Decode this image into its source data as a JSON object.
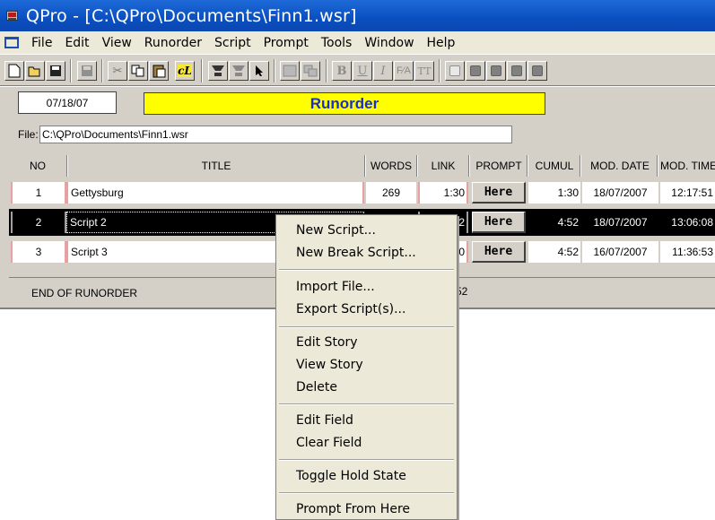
{
  "window": {
    "title": "QPro - [C:\\QPro\\Documents\\Finn1.wsr]",
    "app_icon": "qpro-app-icon"
  },
  "menubar": {
    "doc_icon": "document-window-icon",
    "items": [
      "File",
      "Edit",
      "View",
      "Runorder",
      "Script",
      "Prompt",
      "Tools",
      "Window",
      "Help"
    ]
  },
  "toolbar": {
    "format_buttons": {
      "bold": "B",
      "underline": "U",
      "italic": "I"
    },
    "cl_button": "cL"
  },
  "header": {
    "date": "07/18/07",
    "title": "Runorder"
  },
  "file": {
    "label": "File:",
    "path": "C:\\QPro\\Documents\\Finn1.wsr"
  },
  "table": {
    "columns": [
      "NO",
      "TITLE",
      "WORDS",
      "LINK",
      "PROMPT",
      "CUMUL",
      "MOD. DATE",
      "MOD. TIME"
    ],
    "rows": [
      {
        "no": "1",
        "title": "Gettysburg",
        "words": "269",
        "link": "1:30",
        "prompt": "Here",
        "cumul": "1:30",
        "mod_date": "18/07/2007",
        "mod_time": "12:17:51",
        "selected": false
      },
      {
        "no": "2",
        "title": "Script 2",
        "words": "",
        "link": "22",
        "prompt": "Here",
        "cumul": "4:52",
        "mod_date": "18/07/2007",
        "mod_time": "13:06:08",
        "selected": true
      },
      {
        "no": "3",
        "title": "Script 3",
        "words": "",
        "link": "00",
        "prompt": "Here",
        "cumul": "4:52",
        "mod_date": "16/07/2007",
        "mod_time": "11:36:53",
        "selected": false
      }
    ],
    "end_label": "END OF RUNORDER",
    "end_cumul": "52"
  },
  "context_menu": {
    "groups": [
      [
        "New Script...",
        "New Break Script..."
      ],
      [
        "Import File...",
        "Export Script(s)..."
      ],
      [
        "Edit Story",
        "View Story",
        "Delete"
      ],
      [
        "Edit Field",
        "Clear Field"
      ],
      [
        "Toggle Hold State"
      ],
      [
        "Prompt From Here"
      ]
    ]
  }
}
